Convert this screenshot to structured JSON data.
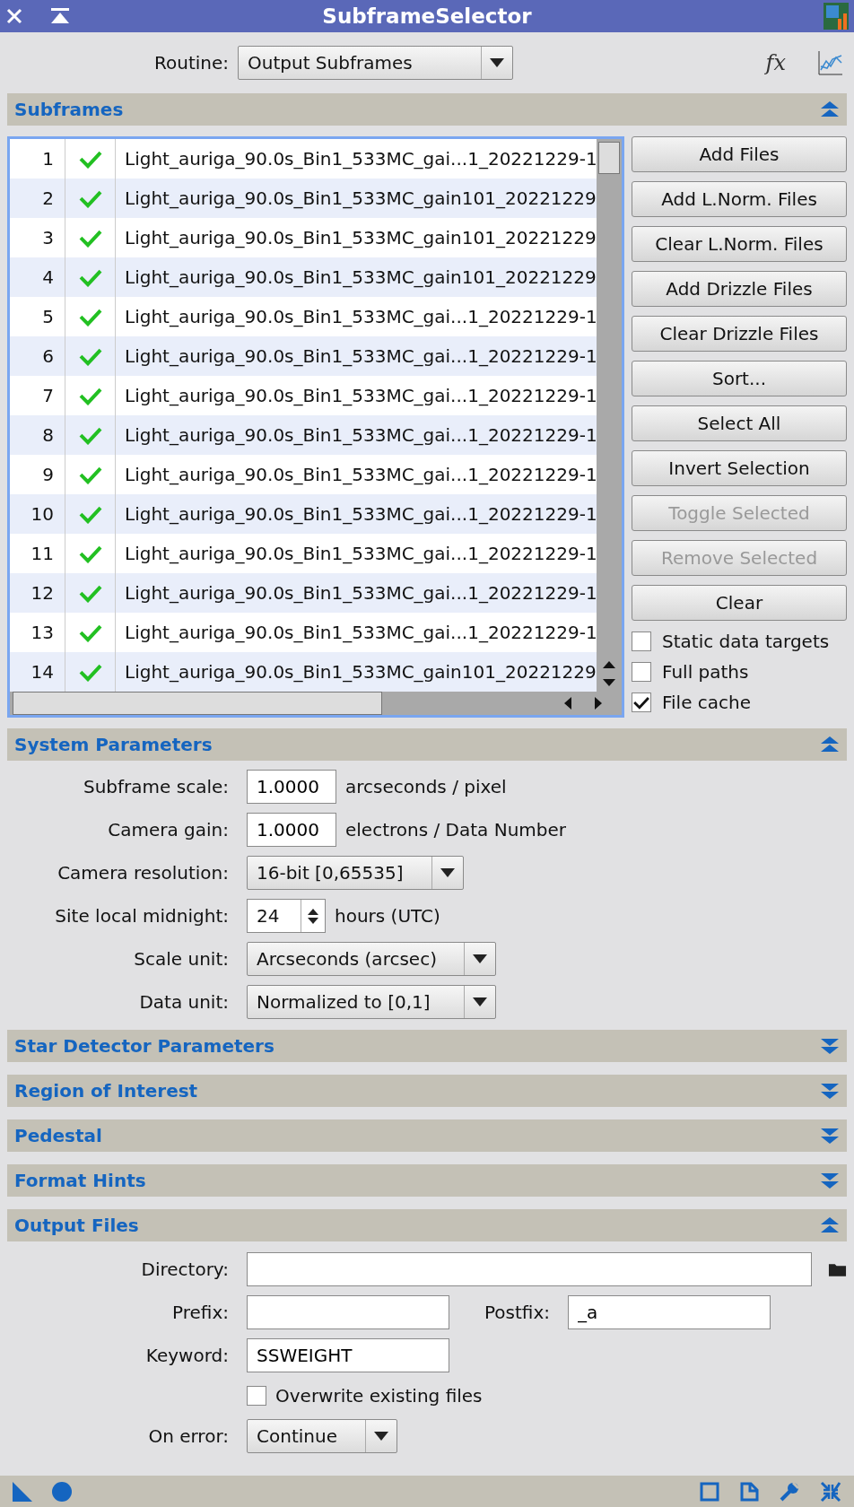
{
  "window": {
    "title": "SubframeSelector"
  },
  "routine": {
    "label": "Routine:",
    "value": "Output Subframes"
  },
  "tools": {
    "function_label": "fx"
  },
  "subframes": {
    "title": "Subframes",
    "expanded": true,
    "files": [
      {
        "index": "1",
        "checked": true,
        "name": "Light_auriga_90.0s_Bin1_533MC_gai...1_20221229-1"
      },
      {
        "index": "2",
        "checked": true,
        "name": "Light_auriga_90.0s_Bin1_533MC_gain101_20221229"
      },
      {
        "index": "3",
        "checked": true,
        "name": "Light_auriga_90.0s_Bin1_533MC_gain101_20221229"
      },
      {
        "index": "4",
        "checked": true,
        "name": "Light_auriga_90.0s_Bin1_533MC_gain101_20221229"
      },
      {
        "index": "5",
        "checked": true,
        "name": "Light_auriga_90.0s_Bin1_533MC_gai...1_20221229-1"
      },
      {
        "index": "6",
        "checked": true,
        "name": "Light_auriga_90.0s_Bin1_533MC_gai...1_20221229-1"
      },
      {
        "index": "7",
        "checked": true,
        "name": "Light_auriga_90.0s_Bin1_533MC_gai...1_20221229-1"
      },
      {
        "index": "8",
        "checked": true,
        "name": "Light_auriga_90.0s_Bin1_533MC_gai...1_20221229-1"
      },
      {
        "index": "9",
        "checked": true,
        "name": "Light_auriga_90.0s_Bin1_533MC_gai...1_20221229-1"
      },
      {
        "index": "10",
        "checked": true,
        "name": "Light_auriga_90.0s_Bin1_533MC_gai...1_20221229-1"
      },
      {
        "index": "11",
        "checked": true,
        "name": "Light_auriga_90.0s_Bin1_533MC_gai...1_20221229-1"
      },
      {
        "index": "12",
        "checked": true,
        "name": "Light_auriga_90.0s_Bin1_533MC_gai...1_20221229-1"
      },
      {
        "index": "13",
        "checked": true,
        "name": "Light_auriga_90.0s_Bin1_533MC_gai...1_20221229-1"
      },
      {
        "index": "14",
        "checked": true,
        "name": "Light_auriga_90.0s_Bin1_533MC_gain101_20221229"
      }
    ],
    "buttons": [
      {
        "label": "Add Files",
        "disabled": false
      },
      {
        "label": "Add L.Norm. Files",
        "disabled": false
      },
      {
        "label": "Clear L.Norm. Files",
        "disabled": false
      },
      {
        "label": "Add Drizzle Files",
        "disabled": false
      },
      {
        "label": "Clear Drizzle Files",
        "disabled": false
      },
      {
        "label": "Sort...",
        "disabled": false
      },
      {
        "label": "Select All",
        "disabled": false
      },
      {
        "label": "Invert Selection",
        "disabled": false
      },
      {
        "label": "Toggle Selected",
        "disabled": true
      },
      {
        "label": "Remove Selected",
        "disabled": true
      },
      {
        "label": "Clear",
        "disabled": false
      }
    ],
    "options": [
      {
        "label": "Static data targets",
        "checked": false
      },
      {
        "label": "Full paths",
        "checked": false
      },
      {
        "label": "File cache",
        "checked": true
      }
    ]
  },
  "system_parameters": {
    "title": "System Parameters",
    "expanded": true,
    "fields": [
      {
        "kind": "input",
        "label": "Subframe scale:",
        "value": "1.0000",
        "unit": "arcseconds / pixel"
      },
      {
        "kind": "input",
        "label": "Camera gain:",
        "value": "1.0000",
        "unit": "electrons / Data Number"
      },
      {
        "kind": "select",
        "label": "Camera resolution:",
        "value": "16-bit [0,65535]"
      },
      {
        "kind": "spin",
        "label": "Site local midnight:",
        "value": "24",
        "unit": "hours (UTC)"
      },
      {
        "kind": "select",
        "label": "Scale unit:",
        "value": "Arcseconds (arcsec)"
      },
      {
        "kind": "select",
        "label": "Data unit:",
        "value": "Normalized to [0,1]"
      }
    ]
  },
  "collapsed_sections": [
    {
      "title": "Star Detector Parameters",
      "expanded": false
    },
    {
      "title": "Region of Interest",
      "expanded": false
    },
    {
      "title": "Pedestal",
      "expanded": false
    },
    {
      "title": "Format Hints",
      "expanded": false
    }
  ],
  "output_files": {
    "title": "Output Files",
    "expanded": true,
    "directory": {
      "label": "Directory:"
    },
    "prefix": {
      "label": "Prefix:"
    },
    "postfix": {
      "label": "Postfix:",
      "value": "_a"
    },
    "keyword": {
      "label": "Keyword:",
      "value": "SSWEIGHT"
    },
    "overwrite": {
      "label": "Overwrite existing files",
      "checked": false
    },
    "on_error": {
      "label": "On error:",
      "value": "Continue"
    }
  }
}
